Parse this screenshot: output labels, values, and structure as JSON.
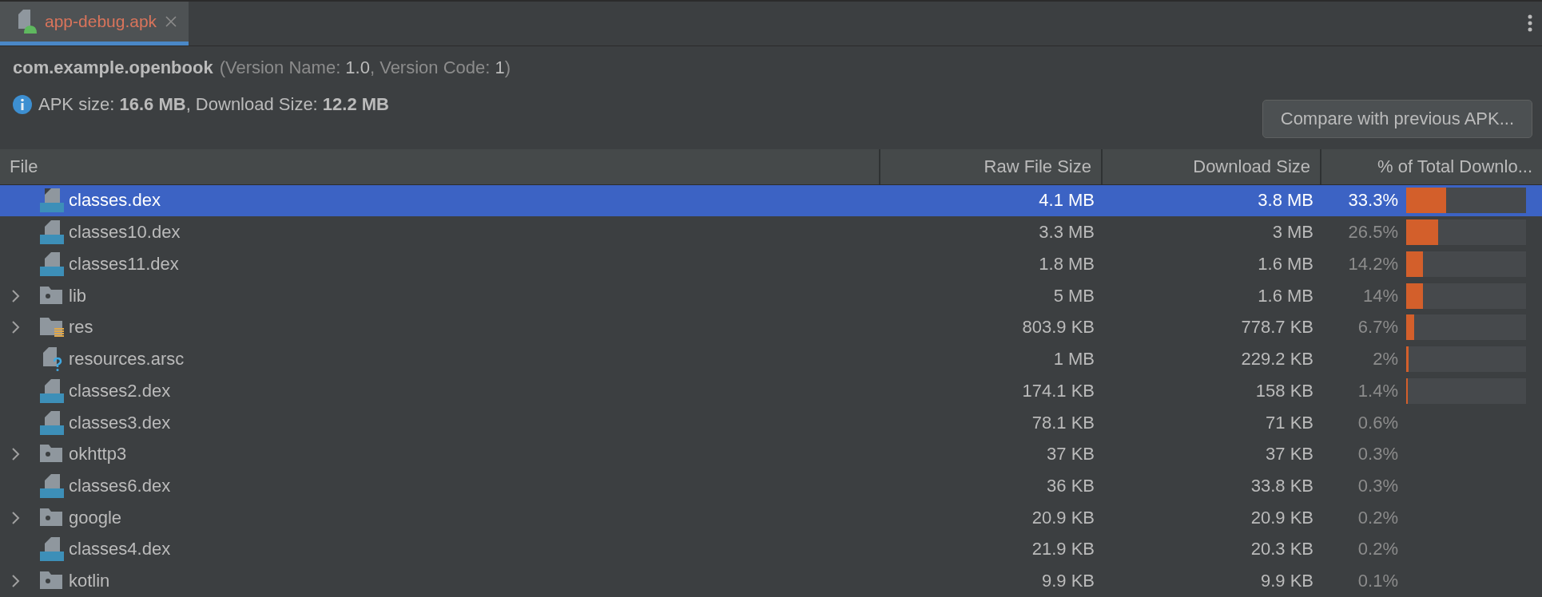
{
  "tab": {
    "label": "app-debug.apk",
    "selected": true
  },
  "header": {
    "package": "com.example.openbook",
    "version_open": "(Version Name: ",
    "version_name": "1.0",
    "version_mid": ", Version Code: ",
    "version_code": "1",
    "version_close": ")",
    "size_text": "APK size: **16.6 MB**, Download Size: **12.2 MB**"
  },
  "compare_button": "Compare with previous APK...",
  "table": {
    "columns": [
      "File",
      "Raw File Size",
      "Download Size",
      "% of Total Downlo..."
    ],
    "rows": [
      {
        "kind": "dex",
        "name": "classes.dex",
        "raw": "4.1 MB",
        "download": "3.8 MB",
        "percent": "33.3%",
        "level": 0.333,
        "selected": true
      },
      {
        "kind": "dex",
        "name": "classes10.dex",
        "raw": "3.3 MB",
        "download": "3 MB",
        "percent": "26.5%",
        "level": 0.265,
        "selected": false
      },
      {
        "kind": "dex",
        "name": "classes11.dex",
        "raw": "1.8 MB",
        "download": "1.6 MB",
        "percent": "14.2%",
        "level": 0.142,
        "selected": false
      },
      {
        "kind": "folder",
        "name": "lib",
        "expanded": false,
        "raw": "5 MB",
        "download": "1.6 MB",
        "percent": "14%",
        "level": 0.14,
        "selected": false
      },
      {
        "kind": "resfolder",
        "name": "res",
        "expanded": false,
        "raw": "803.9 KB",
        "download": "778.7 KB",
        "percent": "6.7%",
        "level": 0.067,
        "selected": false
      },
      {
        "kind": "arsc",
        "name": "resources.arsc",
        "raw": "1 MB",
        "download": "229.2 KB",
        "percent": "2%",
        "level": 0.02,
        "selected": false
      },
      {
        "kind": "dex",
        "name": "classes2.dex",
        "raw": "174.1 KB",
        "download": "158 KB",
        "percent": "1.4%",
        "level": 0.014,
        "selected": false
      },
      {
        "kind": "dex",
        "name": "classes3.dex",
        "raw": "78.1 KB",
        "download": "71 KB",
        "percent": "0.6%",
        "selected": false
      },
      {
        "kind": "folder",
        "name": "okhttp3",
        "expanded": false,
        "raw": "37 KB",
        "download": "37 KB",
        "percent": "0.3%",
        "selected": false
      },
      {
        "kind": "dex",
        "name": "classes6.dex",
        "raw": "36 KB",
        "download": "33.8 KB",
        "percent": "0.3%",
        "selected": false
      },
      {
        "kind": "folder",
        "name": "google",
        "expanded": false,
        "raw": "20.9 KB",
        "download": "20.9 KB",
        "percent": "0.2%",
        "selected": false
      },
      {
        "kind": "dex",
        "name": "classes4.dex",
        "raw": "21.9 KB",
        "download": "20.3 KB",
        "percent": "0.2%",
        "selected": false
      },
      {
        "kind": "folder",
        "name": "kotlin",
        "expanded": false,
        "raw": "9.9 KB",
        "download": "9.9 KB",
        "percent": "0.1%",
        "selected": false
      }
    ]
  }
}
